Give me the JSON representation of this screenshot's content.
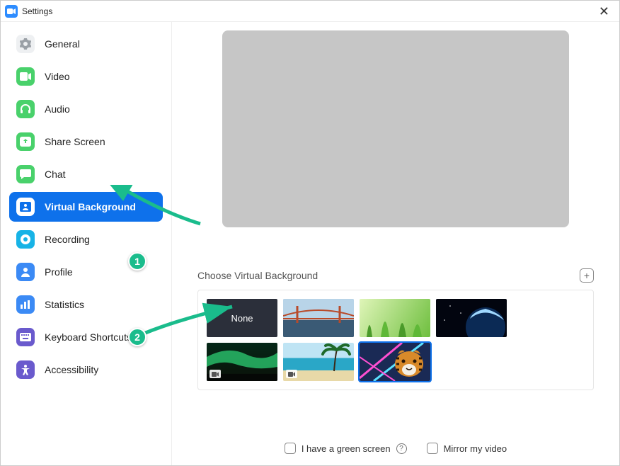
{
  "window": {
    "title": "Settings"
  },
  "sidebar": {
    "items": [
      {
        "label": "General"
      },
      {
        "label": "Video"
      },
      {
        "label": "Audio"
      },
      {
        "label": "Share Screen"
      },
      {
        "label": "Chat"
      },
      {
        "label": "Virtual Background"
      },
      {
        "label": "Recording"
      },
      {
        "label": "Profile"
      },
      {
        "label": "Statistics"
      },
      {
        "label": "Keyboard Shortcuts"
      },
      {
        "label": "Accessibility"
      }
    ]
  },
  "main": {
    "choose_label": "Choose Virtual Background",
    "thumbs": {
      "none_label": "None"
    },
    "options": {
      "green_screen": "I have a green screen",
      "mirror": "Mirror my video"
    }
  },
  "annotations": {
    "badge1": "1",
    "badge2": "2"
  }
}
